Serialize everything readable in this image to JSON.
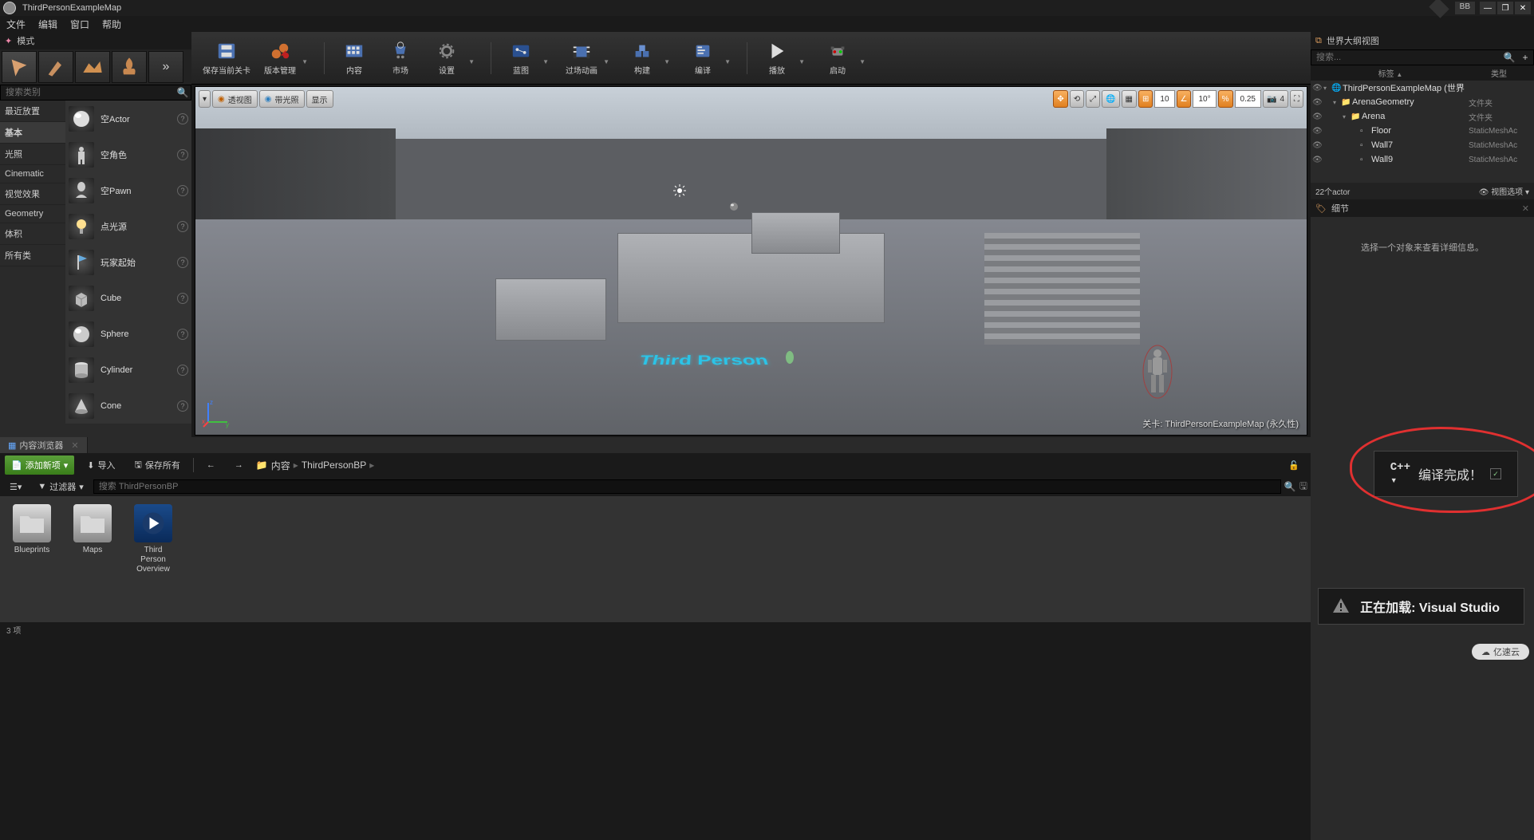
{
  "title": "ThirdPersonExampleMap",
  "user_badge": "BB",
  "menus": [
    "文件",
    "编辑",
    "窗口",
    "帮助"
  ],
  "modes_panel": {
    "title": "模式",
    "search_placeholder": "搜索类别",
    "categories": [
      "最近放置",
      "基本",
      "光照",
      "Cinematic",
      "视觉效果",
      "Geometry",
      "体积",
      "所有类"
    ],
    "active_category": 1,
    "actors": [
      {
        "name": "空Actor",
        "icon": "sphere"
      },
      {
        "name": "空角色",
        "icon": "character"
      },
      {
        "name": "空Pawn",
        "icon": "pawn"
      },
      {
        "name": "点光源",
        "icon": "light"
      },
      {
        "name": "玩家起始",
        "icon": "flag"
      },
      {
        "name": "Cube",
        "icon": "cube"
      },
      {
        "name": "Sphere",
        "icon": "sphere2"
      },
      {
        "name": "Cylinder",
        "icon": "cylinder"
      },
      {
        "name": "Cone",
        "icon": "cone"
      }
    ]
  },
  "toolbar": [
    {
      "key": "save",
      "label": "保存当前关卡",
      "dd": false
    },
    {
      "key": "source",
      "label": "版本管理",
      "dd": true
    },
    {
      "key": "content",
      "label": "内容",
      "dd": false
    },
    {
      "key": "market",
      "label": "市场",
      "dd": false
    },
    {
      "key": "settings",
      "label": "设置",
      "dd": true
    },
    {
      "key": "blueprint",
      "label": "蓝图",
      "dd": true
    },
    {
      "key": "cinematic",
      "label": "过场动画",
      "dd": true
    },
    {
      "key": "build",
      "label": "构建",
      "dd": true
    },
    {
      "key": "compile",
      "label": "编译",
      "dd": true
    },
    {
      "key": "play",
      "label": "播放",
      "dd": true
    },
    {
      "key": "launch",
      "label": "启动",
      "dd": true
    }
  ],
  "viewport": {
    "left_btns": [
      {
        "key": "menu",
        "label": "",
        "icon": "▾"
      },
      {
        "key": "persp",
        "label": "透视图",
        "icon": "●"
      },
      {
        "key": "lit",
        "label": "带光照",
        "icon": "●"
      },
      {
        "key": "show",
        "label": "显示",
        "icon": ""
      }
    ],
    "snap_pos": "10",
    "snap_rot": "10°",
    "snap_scale": "0.25",
    "cam_speed": "4",
    "floor_text": "Third Person",
    "level_label": "关卡:  ThirdPersonExampleMap (永久性)"
  },
  "outliner": {
    "title": "世界大纲视图",
    "search_placeholder": "搜索...",
    "col1": "标签",
    "col2": "类型",
    "rows": [
      {
        "indent": 0,
        "exp": true,
        "icon": "world",
        "label": "ThirdPersonExampleMap (世界",
        "type": ""
      },
      {
        "indent": 1,
        "exp": true,
        "icon": "folder",
        "label": "ArenaGeometry",
        "type": "文件夹"
      },
      {
        "indent": 2,
        "exp": true,
        "icon": "folder",
        "label": "Arena",
        "type": "文件夹"
      },
      {
        "indent": 3,
        "exp": false,
        "icon": "mesh",
        "label": "Floor",
        "type": "StaticMeshAc"
      },
      {
        "indent": 3,
        "exp": false,
        "icon": "mesh",
        "label": "Wall7",
        "type": "StaticMeshAc"
      },
      {
        "indent": 3,
        "exp": false,
        "icon": "mesh",
        "label": "Wall9",
        "type": "StaticMeshAc"
      }
    ],
    "footer_count": "22个actor",
    "footer_opts": "视图选项"
  },
  "details": {
    "title": "细节",
    "empty": "选择一个对象来查看详细信息。"
  },
  "content_browser": {
    "title": "内容浏览器",
    "add_new": "添加新项",
    "import": "导入",
    "save_all": "保存所有",
    "path_root": "内容",
    "path_sub": "ThirdPersonBP",
    "filter_label": "过滤器",
    "search_placeholder": "搜索 ThirdPersonBP",
    "assets": [
      {
        "name": "Blueprints",
        "type": "folder"
      },
      {
        "name": "Maps",
        "type": "folder"
      },
      {
        "name": "Third Person Overview",
        "type": "bp"
      }
    ],
    "footer": "3 项"
  },
  "notif_compile": "编译完成！",
  "notif_loading": "正在加载: Visual Studio",
  "watermark": "亿速云"
}
